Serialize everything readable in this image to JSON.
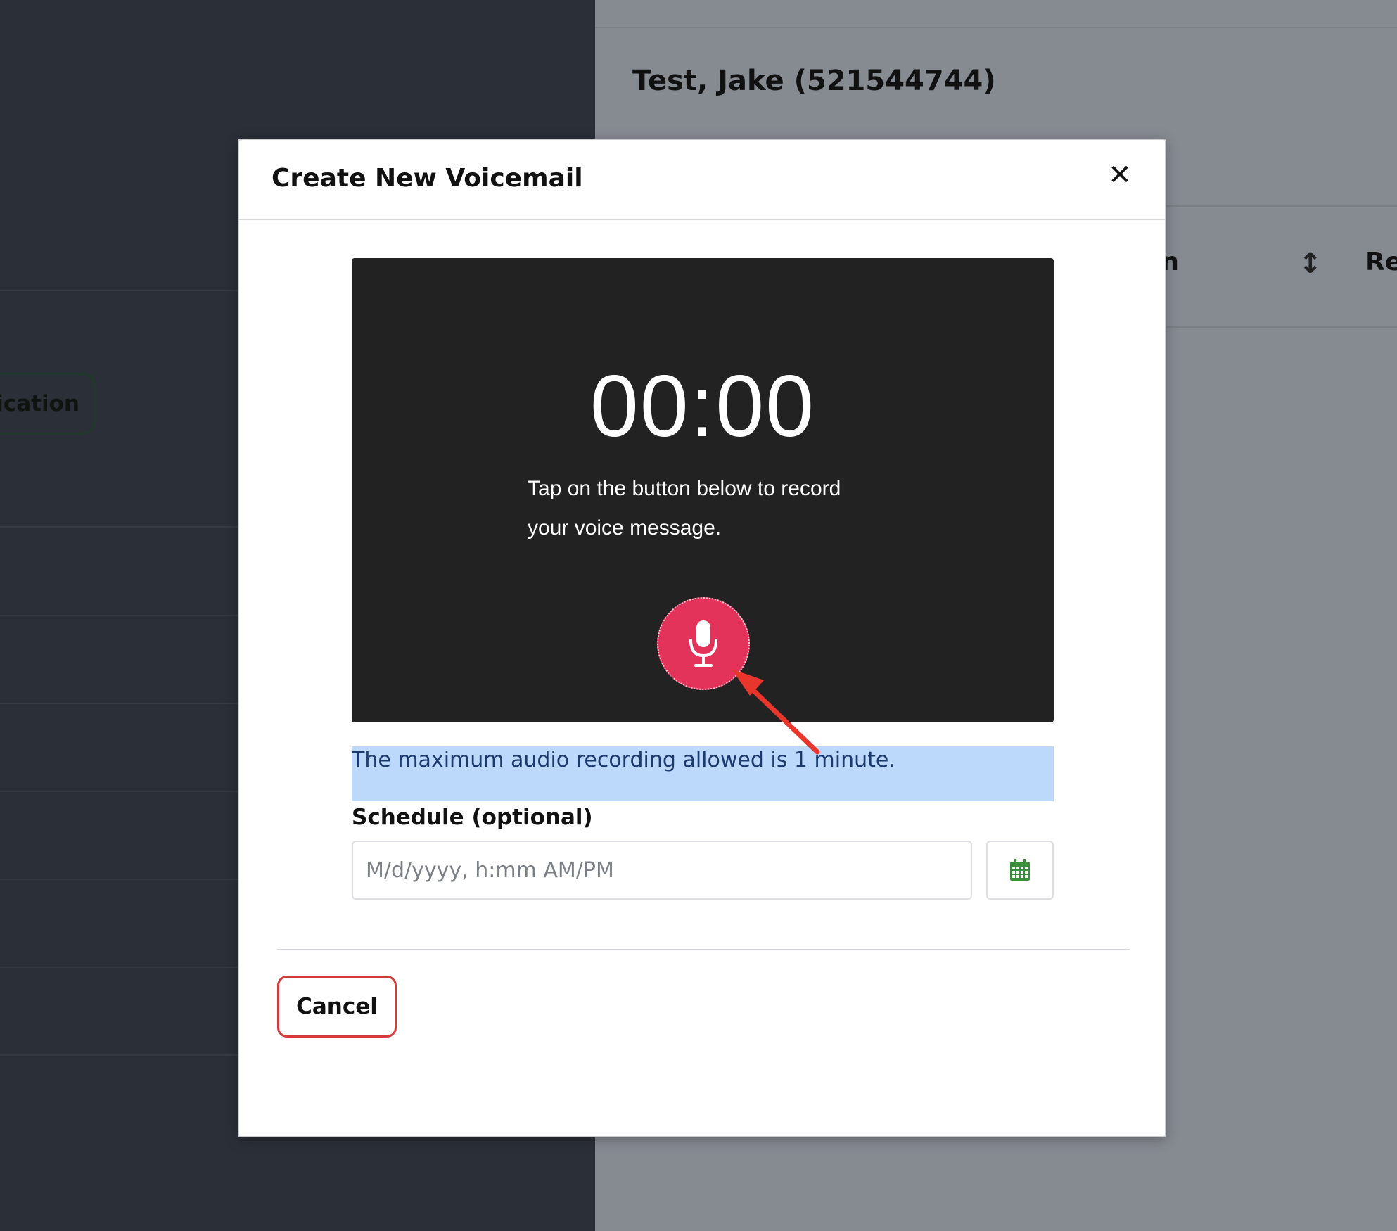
{
  "background": {
    "patient_title": "Test, Jake (521544744)",
    "notification_button_label": "Notification",
    "column_header_partial": "Re",
    "column_header_left_partial": "n",
    "sort_icon": "sort-vertical-icon"
  },
  "modal": {
    "title": "Create New Voicemail",
    "close_icon": "close-icon",
    "recorder": {
      "timer": "00:00",
      "instructions_line1": "Tap on the button below to record",
      "instructions_line2": "your voice message.",
      "mic_icon": "microphone-icon",
      "mic_color": "#e3335a"
    },
    "max_notice": "The maximum audio recording allowed is 1 minute.",
    "schedule": {
      "label": "Schedule (optional)",
      "value": "",
      "placeholder": "M/d/yyyy, h:mm AM/PM",
      "calendar_icon": "calendar-icon"
    },
    "cancel_label": "Cancel"
  },
  "colors": {
    "accent_red": "#d63b3b",
    "notice_bg": "#bcd8fb",
    "calendar_green": "#3a8f3a",
    "annotation_arrow": "#e8362c"
  }
}
